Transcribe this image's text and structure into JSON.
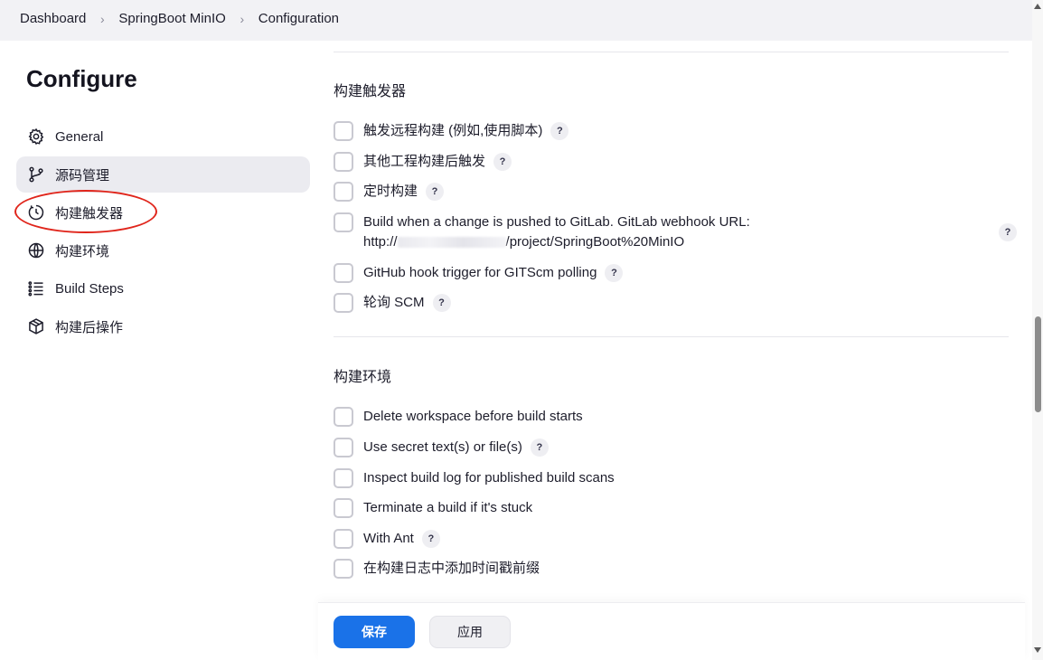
{
  "breadcrumb": {
    "items": [
      "Dashboard",
      "SpringBoot MinIO",
      "Configuration"
    ],
    "separator": ">"
  },
  "page": {
    "title": "Configure"
  },
  "sidebar": {
    "items": [
      {
        "label": "General",
        "icon": "gear-icon"
      },
      {
        "label": "源码管理",
        "icon": "branch-icon",
        "active": true
      },
      {
        "label": "构建触发器",
        "icon": "clock-icon",
        "highlighted": true
      },
      {
        "label": "构建环境",
        "icon": "globe-icon"
      },
      {
        "label": "Build Steps",
        "icon": "list-icon"
      },
      {
        "label": "构建后操作",
        "icon": "package-icon"
      }
    ]
  },
  "triggers": {
    "title": "构建触发器",
    "options": [
      {
        "label": "触发远程构建 (例如,使用脚本)",
        "checked": false,
        "help": "?"
      },
      {
        "label": "其他工程构建后触发",
        "checked": false,
        "help": "?"
      },
      {
        "label": "定时构建",
        "checked": false,
        "help": "?"
      },
      {
        "label": "Build when a change is pushed to GitLab. GitLab webhook URL:",
        "url_prefix": "http://",
        "url_suffix": "/project/SpringBoot%20MinIO",
        "checked": false,
        "help": "?"
      },
      {
        "label": "GitHub hook trigger for GITScm polling",
        "checked": false,
        "help": "?"
      },
      {
        "label": "轮询 SCM",
        "checked": false,
        "help": "?"
      }
    ]
  },
  "environment": {
    "title": "构建环境",
    "options": [
      {
        "label": "Delete workspace before build starts",
        "checked": false
      },
      {
        "label": "Use secret text(s) or file(s)",
        "checked": false,
        "help": "?"
      },
      {
        "label": "Inspect build log for published build scans",
        "checked": false
      },
      {
        "label": "Terminate a build if it's stuck",
        "checked": false
      },
      {
        "label": "With Ant",
        "checked": false,
        "help": "?"
      },
      {
        "label": "在构建日志中添加时间戳前缀",
        "checked": false
      }
    ]
  },
  "actions": {
    "save_label": "保存",
    "apply_label": "应用"
  },
  "colors": {
    "primary": "#1a72e8",
    "highlight": "#e0251b",
    "active_nav_bg": "#ebebf0"
  }
}
